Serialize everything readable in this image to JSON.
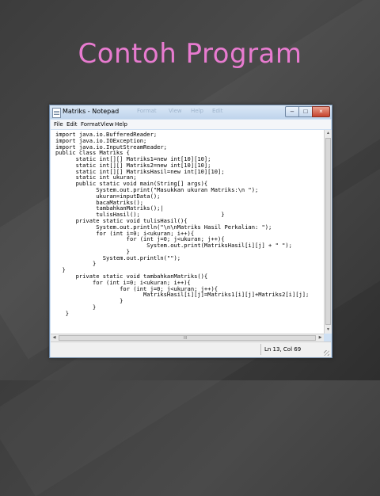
{
  "slide": {
    "title": "Contoh Program"
  },
  "window": {
    "title": "Matriks - Notepad",
    "ghost_menu": [
      "Format",
      "View",
      "Help",
      "Edit"
    ],
    "controls": {
      "minimize": "–",
      "maximize": "□",
      "close": "×"
    }
  },
  "menubar": {
    "items": [
      "File",
      "Edit",
      "Format",
      "View",
      "Help"
    ]
  },
  "editor": {
    "content": "import java.io.BufferedReader;\nimport java.io.IOException;\nimport java.io.InputStreamReader;\npublic class Matriks {\n      static int[][] Matriks1=new int[10][10];\n      static int[][] Matriks2=new int[10][10];\n      static int[][] MatriksHasil=new int[10][10];\n      static int ukuran;\n      public static void main(String[] args){\n            System.out.print(\"Masukkan ukuran Matriks:\\n \");\n            ukuran=inputData();\n            bacaMatriks();\n            tambahkanMatriks();|\n            tulisHasil();                        }\n      private static void tulisHasil(){\n            System.out.println(\"\\n\\nMatriks Hasil Perkalian: \");\n            for (int i=0; i<ukuran; i++){\n                     for (int j=0; j<ukuran; j++){\n                           System.out.print(MatriksHasil[i][j] + \" \");\n                     }\n              System.out.println(\"\");\n           }\n  }\n      private static void tambahkanMatriks(){\n           for (int i=0; i<ukuran; i++){\n                   for (int j=0; j<ukuran; j++){\n                          MatriksHasil[i][j]=Matriks1[i][j]+Matriks2[i][j];\n                   }\n           }\n   }"
  },
  "scrollbar": {
    "up": "▲",
    "down": "▼",
    "left": "◀",
    "right": "▶",
    "grip": "III"
  },
  "statusbar": {
    "position": "Ln 13, Col 69"
  }
}
